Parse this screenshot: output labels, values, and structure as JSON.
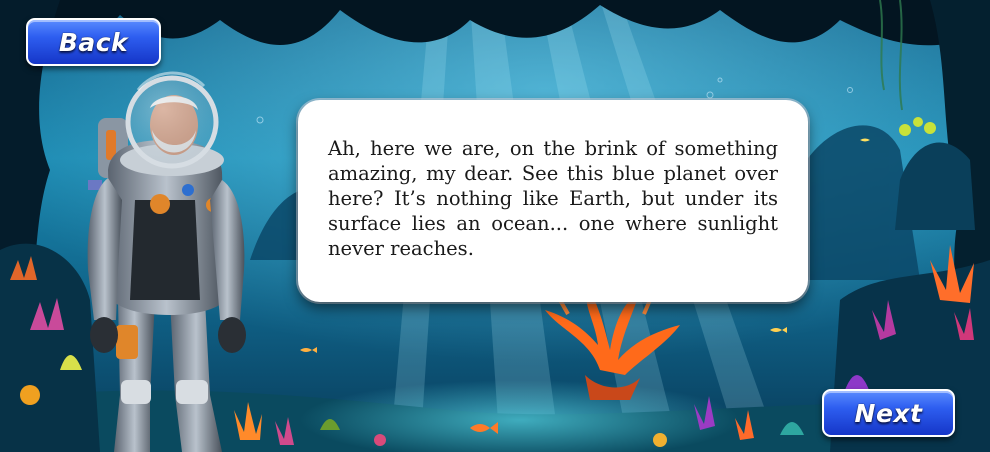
{
  "buttons": {
    "back_label": "Back",
    "next_label": "Next"
  },
  "dialog": {
    "text": "Ah, here we are, on the brink of something amazing, my dear. See this blue planet over here? It’s nothing like Earth, but under its surface lies an ocean... one where sunlight never reaches."
  },
  "colors": {
    "button_blue": "#2e5ef0",
    "dialog_bg": "#ffffff",
    "ocean_deep": "#052238",
    "ocean_light": "#1f9cc4",
    "coral_orange": "#ff6a1a"
  },
  "icons": {
    "character": "astronaut-diver-character",
    "scenery": "underwater-coral-reef"
  }
}
